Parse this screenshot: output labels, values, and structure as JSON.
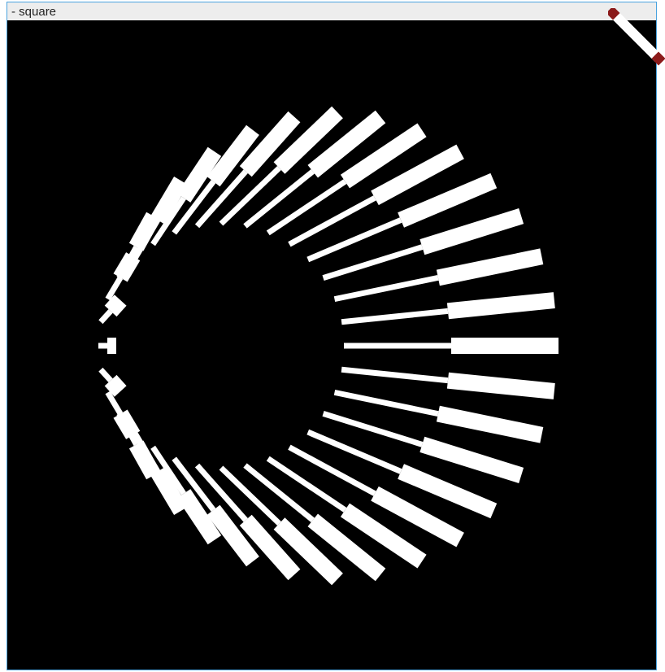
{
  "window": {
    "title": "- square"
  },
  "artwork": {
    "description_free": true,
    "background_color": "#000000",
    "stroke_color": "#ffffff",
    "rays": 32
  },
  "resize_handle": {
    "icon": "resize-diagonal-icon",
    "accent_color": "#8b1a1a"
  }
}
